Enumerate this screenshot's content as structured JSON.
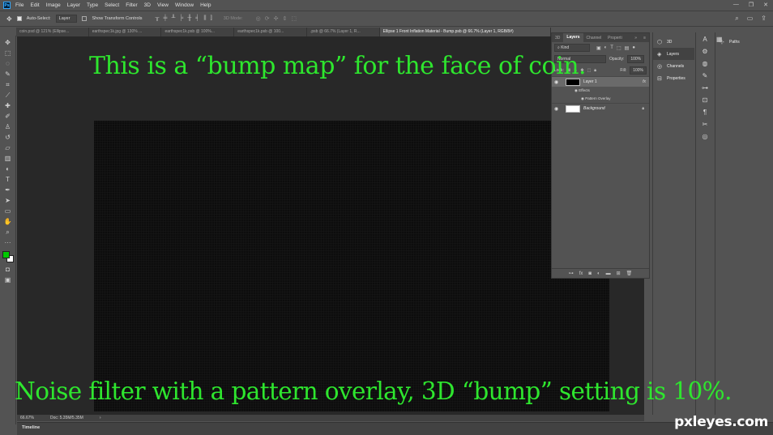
{
  "menubar": {
    "logo": "Ps",
    "items": [
      "File",
      "Edit",
      "Image",
      "Layer",
      "Type",
      "Select",
      "Filter",
      "3D",
      "View",
      "Window",
      "Help"
    ],
    "window_controls": [
      "—",
      "❐",
      "✕"
    ]
  },
  "options": {
    "auto_select_label": "Auto-Select:",
    "auto_select_value": "Layer",
    "show_transform_label": "Show Transform Controls",
    "mode_3d_label": "3D Mode:"
  },
  "tabs": [
    {
      "label": "coin.psd @ 121% (Ellipse..."
    },
    {
      "label": "earthspec1k.jpg @ 130% ..."
    },
    {
      "label": "earthspec1k.psb @ 100%..."
    },
    {
      "label": "earthspec1k.psb @ 100..."
    },
    {
      "label": ".psb @ 66.7% (Layer 1, R..."
    },
    {
      "label": "Ellipse 1 Front Inflation Material - Bump.psb @ 66.7% (Layer 1, RGB/8#)"
    }
  ],
  "captions": {
    "top": "This is a “bump map” for the face of coin.",
    "bottom": "Noise filter with a pattern overlay, 3D “bump” setting is 10%."
  },
  "status": {
    "zoom": "66.67%",
    "doc": "Doc: 5.35M/5.35M",
    "arrow": "›"
  },
  "timeline": {
    "label": "Timeline"
  },
  "layers_panel": {
    "tabs": [
      "3D",
      "Layers",
      "Channel",
      "Properti"
    ],
    "kind_label": "Kind",
    "blend_mode": "Normal",
    "opacity_label": "Opacity:",
    "opacity_value": "100%",
    "lock_label": "Lock:",
    "fill_label": "Fill:",
    "fill_value": "100%",
    "layers": [
      {
        "name": "Layer 1",
        "fx": "fx"
      },
      {
        "name": "Background"
      }
    ],
    "effects_label": "Effects",
    "pattern_overlay_label": "Pattern Overlay"
  },
  "side_panels": {
    "items": [
      {
        "label": "3D",
        "icon": "cube-icon"
      },
      {
        "label": "Layers",
        "icon": "layers-icon"
      },
      {
        "label": "Channels",
        "icon": "channels-icon"
      },
      {
        "label": "Properties",
        "icon": "properties-icon"
      }
    ],
    "paths_label": "Paths"
  },
  "watermark": "pxleyes.com",
  "colors": {
    "foreground": "#00c800",
    "background": "#ffffff",
    "caption": "#2ee62e"
  }
}
